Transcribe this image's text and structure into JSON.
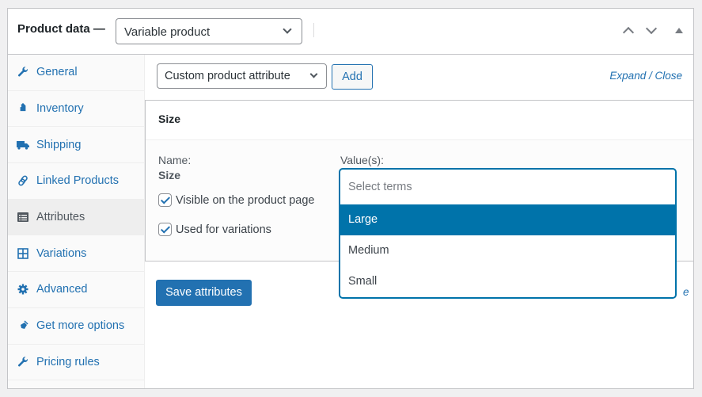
{
  "header": {
    "title": "Product data —",
    "product_type": "Variable product"
  },
  "sidebar": {
    "items": [
      {
        "label": "General",
        "icon": "wrench-icon",
        "active": false
      },
      {
        "label": "Inventory",
        "icon": "tag-icon",
        "active": false
      },
      {
        "label": "Shipping",
        "icon": "truck-icon",
        "active": false
      },
      {
        "label": "Linked Products",
        "icon": "link-icon",
        "active": false
      },
      {
        "label": "Attributes",
        "icon": "list-icon",
        "active": true
      },
      {
        "label": "Variations",
        "icon": "grid-icon",
        "active": false
      },
      {
        "label": "Advanced",
        "icon": "gear-icon",
        "active": false
      },
      {
        "label": "Get more options",
        "icon": "plugin-icon",
        "active": false
      },
      {
        "label": "Pricing rules",
        "icon": "wrench-icon",
        "active": false
      }
    ]
  },
  "toolbar": {
    "attribute_select": "Custom product attribute",
    "add_label": "Add",
    "expand_label": "Expand",
    "separator": " / ",
    "close_label": "Close"
  },
  "attribute": {
    "title": "Size",
    "name_label": "Name:",
    "name_value": "Size",
    "visible_label": "Visible on the product page",
    "visible_checked": true,
    "variations_label": "Used for variations",
    "variations_checked": true,
    "values_label": "Value(s):"
  },
  "dropdown": {
    "placeholder": "Select terms",
    "options": [
      "Large",
      "Medium",
      "Small"
    ],
    "highlighted": "Large"
  },
  "save_label": "Save attributes",
  "colors": {
    "accent": "#2271b1",
    "highlight": "#0073aa"
  }
}
